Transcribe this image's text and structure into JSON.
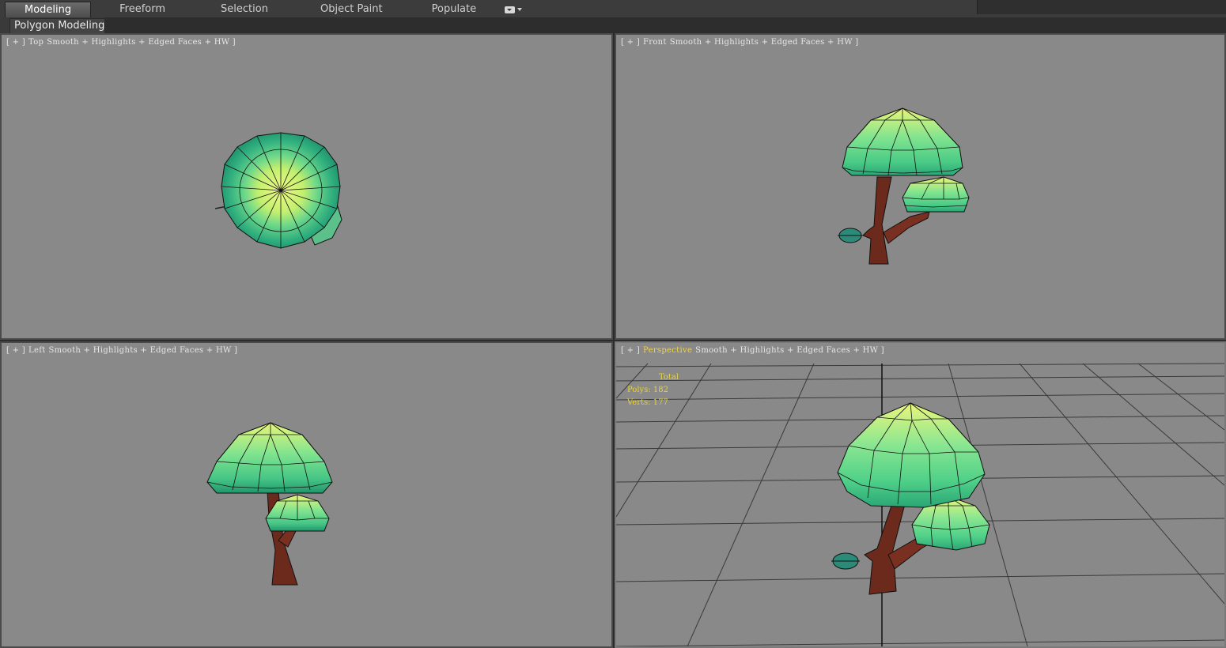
{
  "ribbon": {
    "tabs": [
      "Modeling",
      "Freeform",
      "Selection",
      "Object Paint",
      "Populate"
    ]
  },
  "subbar": {
    "tab": "Polygon Modeling"
  },
  "viewports": {
    "top": {
      "plus": "[ + ]",
      "view": "Top",
      "shading": "Smooth + Highlights + Edged Faces + HW ]"
    },
    "front": {
      "plus": "[ + ]",
      "view": "Front",
      "shading": "Smooth + Highlights + Edged Faces + HW ]"
    },
    "left": {
      "plus": "[ + ]",
      "view": "Left",
      "shading": "Smooth + Highlights + Edged Faces + HW ]"
    },
    "persp": {
      "plus": "[ + ]",
      "view": "Perspective",
      "shading": "Smooth + Highlights + Edged Faces + HW ]"
    }
  },
  "stats": {
    "total": "Total",
    "polys": "Polys: 182",
    "verts": "Verts: 177"
  },
  "colors": {
    "viewport_bg": "#898989",
    "canopy_top": "#e8f57a",
    "canopy_mid": "#58d08a",
    "canopy_dark": "#1a8c66",
    "trunk": "#6b2a1c",
    "active_label": "#f2d34a"
  }
}
